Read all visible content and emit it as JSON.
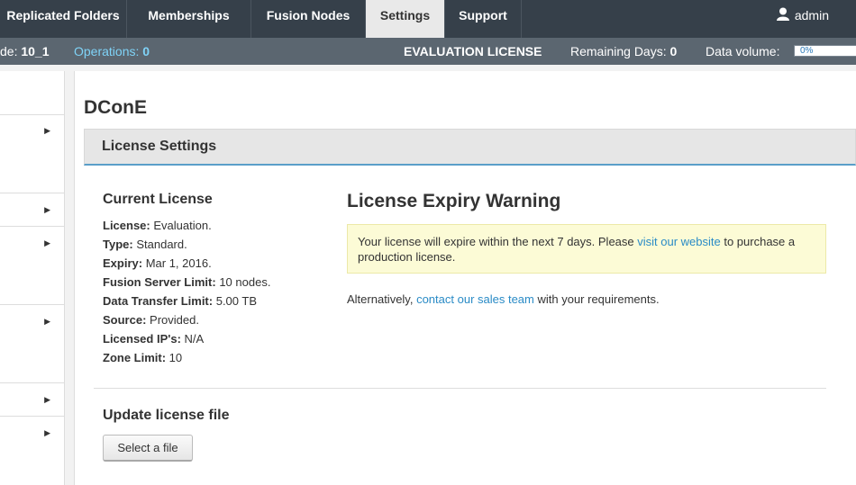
{
  "nav": {
    "tabs": [
      {
        "label": "Replicated Folders"
      },
      {
        "label": "Memberships"
      },
      {
        "label": "Fusion Nodes"
      },
      {
        "label": "Settings"
      },
      {
        "label": "Support"
      }
    ],
    "user": "admin"
  },
  "status": {
    "node_prefix": "de:",
    "node_value": "10_1",
    "operations_label": "Operations:",
    "operations_value": "0",
    "license": "EVALUATION LICENSE",
    "remaining_label": "Remaining Days:",
    "remaining_value": "0",
    "volume_label": "Data volume:",
    "volume_percent": "0%",
    "volume_fraction": 0
  },
  "page": {
    "title": "DConE",
    "panel_title": "License Settings"
  },
  "current_license": {
    "heading": "Current License",
    "rows": [
      {
        "label": "License:",
        "value": "Evaluation."
      },
      {
        "label": "Type:",
        "value": "Standard."
      },
      {
        "label": "Expiry:",
        "value": "Mar 1, 2016."
      },
      {
        "label": "Fusion Server Limit:",
        "value": "10 nodes."
      },
      {
        "label": "Data Transfer Limit:",
        "value": "5.00 TB"
      },
      {
        "label": "Source:",
        "value": "Provided."
      },
      {
        "label": "Licensed IP's:",
        "value": "N/A"
      },
      {
        "label": "Zone Limit:",
        "value": "10"
      }
    ]
  },
  "warning": {
    "title": "License Expiry Warning",
    "text_before": "Your license will expire within the next 7 days. Please ",
    "link": "visit our website",
    "text_after": " to purchase a production license.",
    "alt_before": "Alternatively, ",
    "alt_link": "contact our sales team",
    "alt_after": " with your requirements."
  },
  "update": {
    "heading": "Update license file",
    "button": "Select a file"
  }
}
